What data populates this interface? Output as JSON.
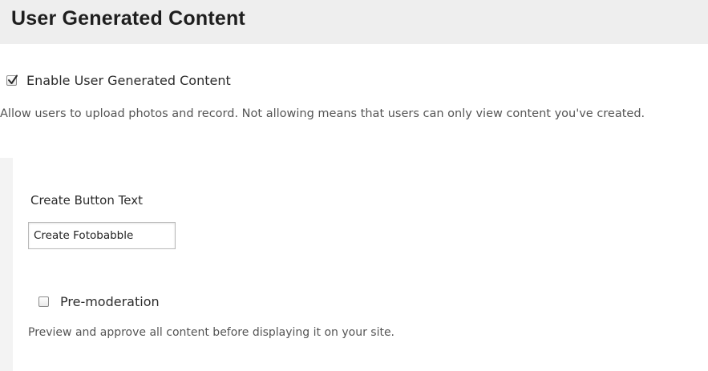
{
  "section": {
    "title": "User Generated Content"
  },
  "enable_ugc": {
    "label": "Enable User Generated Content",
    "checked": true,
    "description": "Allow users to upload photos and record. Not allowing means that users can only view content you've created."
  },
  "create_button_text": {
    "label": "Create Button Text",
    "value": "Create Fotobabble"
  },
  "pre_moderation": {
    "label": "Pre-moderation",
    "checked": false,
    "description": "Preview and approve all content before displaying it on your site."
  },
  "colors": {
    "header_background": "#eeeeee",
    "text": "#333333",
    "muted_text": "#555555"
  },
  "icons": {
    "enable_checkbox": "checkbox-checked-icon",
    "premod_checkbox": "checkbox-unchecked-icon"
  }
}
